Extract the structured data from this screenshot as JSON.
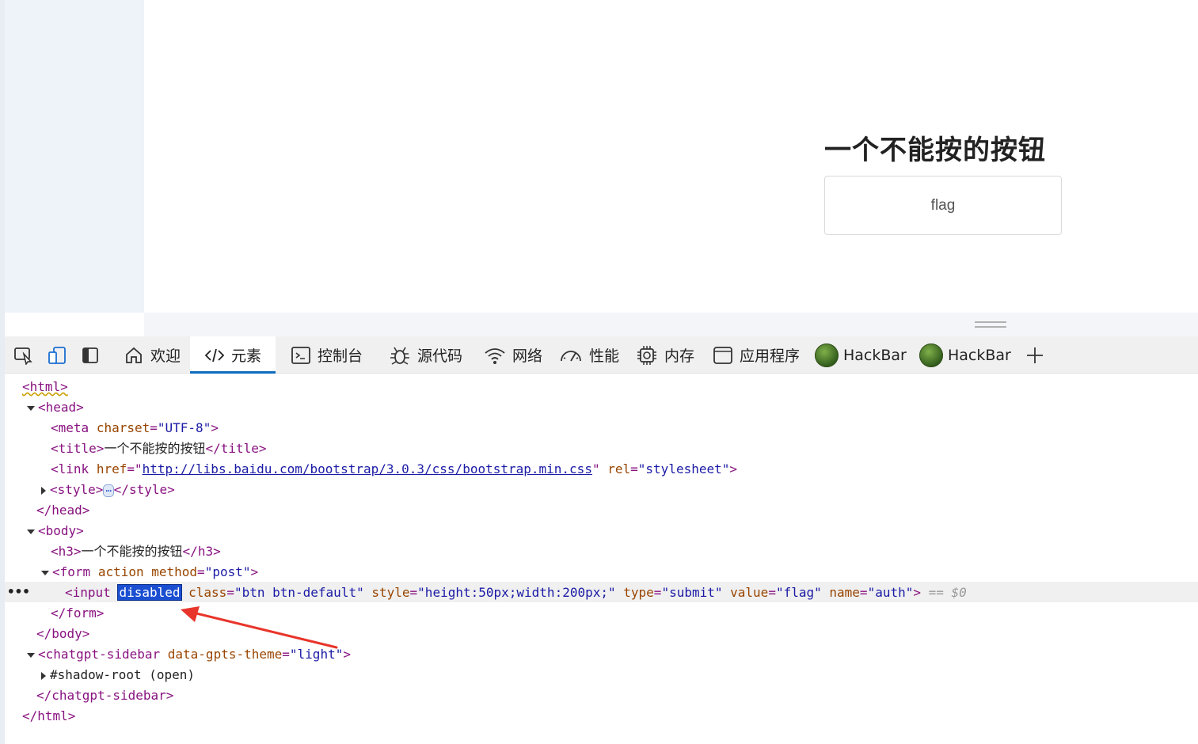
{
  "page": {
    "heading": "一个不能按的按钮",
    "button_value": "flag"
  },
  "devtools": {
    "toolbar": {
      "tabs": [
        {
          "label": "欢迎",
          "icon": "home-icon"
        },
        {
          "label": "元素",
          "icon": "code-icon",
          "active": true
        },
        {
          "label": "控制台",
          "icon": "console-icon"
        },
        {
          "label": "源代码",
          "icon": "bug-icon"
        },
        {
          "label": "网络",
          "icon": "wifi-icon"
        },
        {
          "label": "性能",
          "icon": "gauge-icon"
        },
        {
          "label": "内存",
          "icon": "chip-icon"
        },
        {
          "label": "应用程序",
          "icon": "window-icon"
        },
        {
          "label": "HackBar",
          "icon": "hackbar-logo-icon"
        },
        {
          "label": "HackBar",
          "icon": "hackbar-logo-icon"
        }
      ]
    },
    "dom_tree": {
      "html_open": "<html>",
      "head_open": "<head>",
      "meta_tag": "<meta",
      "meta_attr": "charset",
      "meta_val": "\"UTF-8\"",
      "title_open": "<title>",
      "title_text": "一个不能按的按钮",
      "title_close": "</title>",
      "link_tag": "<link",
      "link_href_attr": "href",
      "link_href": "http://libs.baidu.com/bootstrap/3.0.3/css/bootstrap.min.css",
      "link_rel_attr": "rel",
      "link_rel": "\"stylesheet\"",
      "style_open": "<style>",
      "style_ellipsis": "⋯",
      "style_close": "</style>",
      "head_close": "</head>",
      "body_open": "<body>",
      "h3_open": "<h3>",
      "h3_text": "一个不能按的按钮",
      "h3_close": "</h3>",
      "form_tag": "<form",
      "form_action": "action",
      "form_method_attr": "method",
      "form_method": "\"post\"",
      "input_tag": "<input",
      "input_disabled": "disabled",
      "input_class_attr": "class",
      "input_class": "\"btn btn-default\"",
      "input_style_attr": "style",
      "input_style": "\"height:50px;width:200px;\"",
      "input_type_attr": "type",
      "input_type": "\"submit\"",
      "input_value_attr": "value",
      "input_value": "\"flag\"",
      "input_name_attr": "name",
      "input_name": "\"auth\"",
      "selected_marker": "== $0",
      "row_dots": "•••",
      "form_close": "</form>",
      "body_close": "</body>",
      "sidebar_tag": "<chatgpt-sidebar",
      "sidebar_attr": "data-gpts-theme",
      "sidebar_val": "\"light\"",
      "shadow_root": "#shadow-root (open)",
      "sidebar_close": "</chatgpt-sidebar>",
      "html_close": "</html>"
    }
  },
  "colors": {
    "tag": "#881280",
    "attribute": "#994500",
    "value": "#1a1aa6",
    "highlight": "#1b4fd1",
    "annotation_arrow": "#e8352b",
    "active_tab_underline": "#0f6cbd"
  }
}
